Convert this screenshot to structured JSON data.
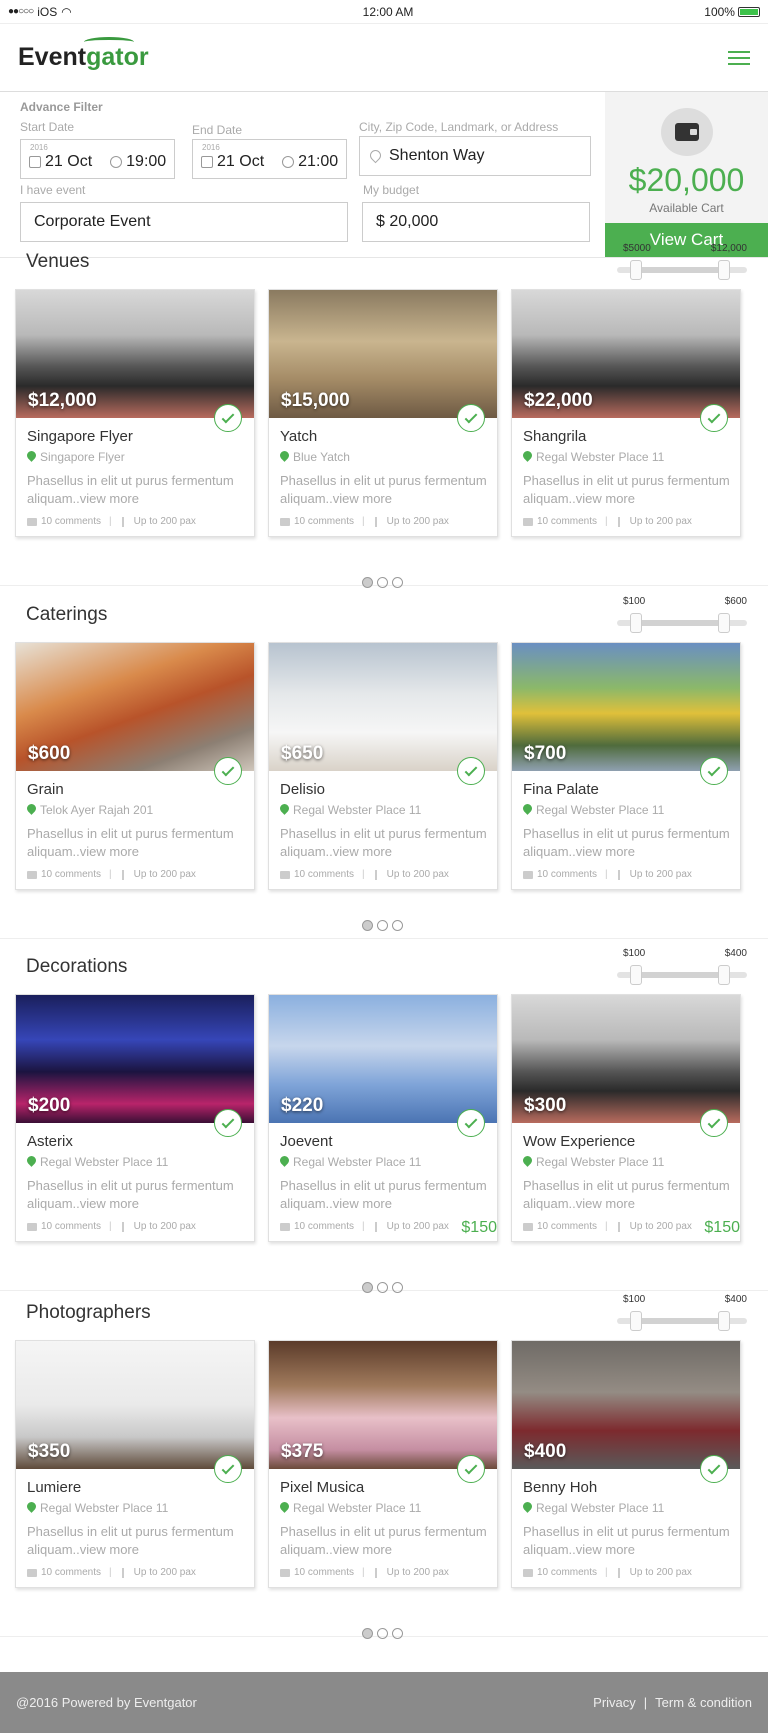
{
  "status": {
    "carrier": "iOS",
    "time": "12:00 AM",
    "battery": "100%"
  },
  "brand": {
    "name_a": "Event",
    "name_b": "gator",
    "accent": "#4caf50"
  },
  "filter": {
    "title": "Advance Filter",
    "start_label": "Start Date",
    "end_label": "End Date",
    "city_label": "City, Zip Code, Landmark, or Address",
    "event_label": "I have event",
    "budget_label": "My budget",
    "start_year": "2016",
    "start_date": "21 Oct",
    "start_time": "19:00",
    "end_year": "2016",
    "end_date": "21 Oct",
    "end_time": "21:00",
    "city_value": "Shenton Way",
    "event_value": "Corporate Event",
    "budget_value": "$ 20,000"
  },
  "cart": {
    "amount": "$20,000",
    "label": "Available Cart",
    "button": "View Cart"
  },
  "sections": [
    {
      "title": "Venues",
      "min": "$5000",
      "max": "$12,000",
      "cards": [
        {
          "price": "$12,000",
          "name": "Singapore Flyer",
          "location": "Singapore Flyer",
          "desc": "Phasellus in elit ut purus fermentum aliquam..view more",
          "comments": "10 comments",
          "pax": "Up to 200 pax"
        },
        {
          "price": "$15,000",
          "name": "Yatch",
          "location": "Blue Yatch",
          "desc": "Phasellus in elit ut purus fermentum aliquam..view more",
          "comments": "10 comments",
          "pax": "Up to 200 pax"
        },
        {
          "price": "$22,000",
          "name": "Shangrila",
          "location": "Regal Webster Place 11",
          "desc": "Phasellus in elit ut purus fermentum aliquam..view more",
          "comments": "10 comments",
          "pax": "Up to 200 pax"
        }
      ]
    },
    {
      "title": "Caterings",
      "min": "$100",
      "max": "$600",
      "cards": [
        {
          "price": "$600",
          "name": "Grain",
          "location": "Telok Ayer Rajah 201",
          "desc": "Phasellus in elit ut purus fermentum aliquam..view more",
          "comments": "10 comments",
          "pax": "Up to 200 pax"
        },
        {
          "price": "$650",
          "name": "Delisio",
          "location": "Regal Webster Place 11",
          "desc": "Phasellus in elit ut purus fermentum aliquam..view more",
          "comments": "10 comments",
          "pax": "Up to 200 pax"
        },
        {
          "price": "$700",
          "name": "Fina Palate",
          "location": "Regal Webster Place 11",
          "desc": "Phasellus in elit ut purus fermentum aliquam..view more",
          "comments": "10 comments",
          "pax": "Up to 200 pax"
        }
      ]
    },
    {
      "title": "Decorations",
      "min": "$100",
      "max": "$400",
      "cards": [
        {
          "price": "$200",
          "name": "Asterix",
          "location": "Regal Webster Place 11",
          "desc": "Phasellus in elit ut purus fermentum aliquam..view more",
          "comments": "10 comments",
          "pax": "Up to 200 pax"
        },
        {
          "price": "$220",
          "name": "Joevent",
          "location": "Regal Webster Place 11",
          "desc": "Phasellus in elit ut purus fermentum aliquam..view more",
          "comments": "10 comments",
          "pax": "Up to 200 pax",
          "big": "$150"
        },
        {
          "price": "$300",
          "name": "Wow Experience",
          "location": "Regal Webster Place 11",
          "desc": "Phasellus in elit ut purus fermentum aliquam..view more",
          "comments": "10 comments",
          "pax": "Up to 200 pax",
          "big": "$150"
        }
      ]
    },
    {
      "title": "Photographers",
      "min": "$100",
      "max": "$400",
      "cards": [
        {
          "price": "$350",
          "name": "Lumiere",
          "location": "Regal Webster Place 11",
          "desc": "Phasellus in elit ut purus fermentum aliquam..view more",
          "comments": "10 comments",
          "pax": "Up to 200 pax"
        },
        {
          "price": "$375",
          "name": "Pixel Musica",
          "location": "Regal Webster Place 11",
          "desc": "Phasellus in elit ut purus fermentum aliquam..view more",
          "comments": "10 comments",
          "pax": "Up to 200 pax"
        },
        {
          "price": "$400",
          "name": "Benny Hoh",
          "location": "Regal Webster Place 11",
          "desc": "Phasellus in elit ut purus fermentum aliquam..view more",
          "comments": "10 comments",
          "pax": "Up to 200 pax"
        }
      ]
    }
  ],
  "footer": {
    "copyright": "@2016 Powered by Eventgator",
    "privacy": "Privacy",
    "terms": "Term & condition"
  }
}
